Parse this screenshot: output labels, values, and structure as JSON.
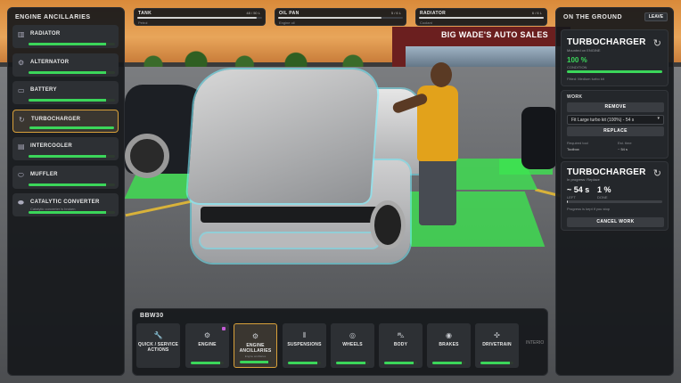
{
  "colors": {
    "accent_gold": "#d9a13a",
    "condition_green": "#3bd65a",
    "panel_bg": "#16181b",
    "tile_bg": "#2d3034"
  },
  "scene": {
    "shop_sign": "BIG WADE'S AUTO SALES"
  },
  "left_panel": {
    "title": "ENGINE ANCILLARIES",
    "items": [
      {
        "label": "RADIATOR",
        "icon": "radiator-icon",
        "glyph": "▥",
        "sub": "",
        "condition": 0.9,
        "active": false
      },
      {
        "label": "ALTERNATOR",
        "icon": "alternator-icon",
        "glyph": "⚙",
        "sub": "",
        "condition": 0.9,
        "active": false
      },
      {
        "label": "BATTERY",
        "icon": "battery-icon",
        "glyph": "▭",
        "sub": "",
        "condition": 0.9,
        "active": false
      },
      {
        "label": "TURBOCHARGER",
        "icon": "turbo-icon",
        "glyph": "↻",
        "sub": "",
        "condition": 1.0,
        "active": true
      },
      {
        "label": "INTERCOOLER",
        "icon": "intercooler-icon",
        "glyph": "▤",
        "sub": "",
        "condition": 0.9,
        "active": false
      },
      {
        "label": "MUFFLER",
        "icon": "muffler-icon",
        "glyph": "⬭",
        "sub": "",
        "condition": 0.9,
        "active": false
      },
      {
        "label": "CATALYTIC CONVERTER",
        "icon": "catalytic-icon",
        "glyph": "⬬",
        "sub": "Catalytic converter is broken",
        "condition": 0.9,
        "active": false
      }
    ]
  },
  "gauges": [
    {
      "title": "TANK",
      "value": "48 / 50 L",
      "sub": "Petrol",
      "fraction": 0.96
    },
    {
      "title": "OIL PAN",
      "value": "5 / 6 L",
      "sub": "Engine oil",
      "fraction": 0.83
    },
    {
      "title": "RADIATOR",
      "value": "6 / 6 L",
      "sub": "Coolant",
      "fraction": 1.0
    }
  ],
  "right_panel": {
    "title": "ON THE GROUND",
    "leave_label": "LEAVE",
    "part_card": {
      "title": "TURBOCHARGER",
      "subtitle": "Mounted on ENGINE",
      "condition_value": "100 %",
      "condition_label": "CONDITION",
      "condition": 1.0,
      "fitted": "Fitted: Medium turbo kit"
    },
    "work": {
      "title": "WORK",
      "remove_label": "REMOVE",
      "select_value": "Fit Large turbo kit (100%) - 54 s",
      "replace_label": "REPLACE",
      "stat1_label": "Required tool",
      "stat1_value": "Toolbox",
      "stat2_label": "Est. time",
      "stat2_value": "~ 54 s"
    },
    "progress_card": {
      "title": "TURBOCHARGER",
      "subtitle": "In progress: Replace",
      "time_value": "~ 54 s",
      "time_label": "LEFT",
      "percent_value": "1 %",
      "percent_label": "DONE",
      "progress": 0.01,
      "note": "Progress is kept if you stop",
      "cancel_label": "CANCEL WORK"
    }
  },
  "bottom_panel": {
    "title": "BBW30",
    "categories": [
      {
        "label": "QUICK / SERVICE ACTIONS",
        "icon": "wrench-icon",
        "glyph": "🔧",
        "sub": "",
        "condition": 0,
        "active": false,
        "badge": false
      },
      {
        "label": "ENGINE",
        "icon": "engine-icon",
        "glyph": "⚙",
        "sub": "",
        "condition": 0.9,
        "active": false,
        "badge": true
      },
      {
        "label": "ENGINE ANCILLARIES",
        "icon": "ancillaries-icon",
        "glyph": "⚙",
        "sub": "Engine ancillaries",
        "condition": 0.9,
        "active": true,
        "badge": false
      },
      {
        "label": "SUSPENSIONS",
        "icon": "suspension-icon",
        "glyph": "⦀",
        "sub": "",
        "condition": 0.9,
        "active": false,
        "badge": false
      },
      {
        "label": "WHEELS",
        "icon": "wheel-icon",
        "glyph": "◎",
        "sub": "",
        "condition": 0.9,
        "active": false,
        "badge": false
      },
      {
        "label": "BODY",
        "icon": "body-icon",
        "glyph": "⛍",
        "sub": "",
        "condition": 0.9,
        "active": false,
        "badge": false
      },
      {
        "label": "BRAKES",
        "icon": "brakes-icon",
        "glyph": "◉",
        "sub": "",
        "condition": 0.9,
        "active": false,
        "badge": false
      },
      {
        "label": "DRIVETRAIN",
        "icon": "drivetrain-icon",
        "glyph": "✣",
        "sub": "",
        "condition": 0.9,
        "active": false,
        "badge": false
      }
    ],
    "overflow_label": "INTERIO"
  }
}
